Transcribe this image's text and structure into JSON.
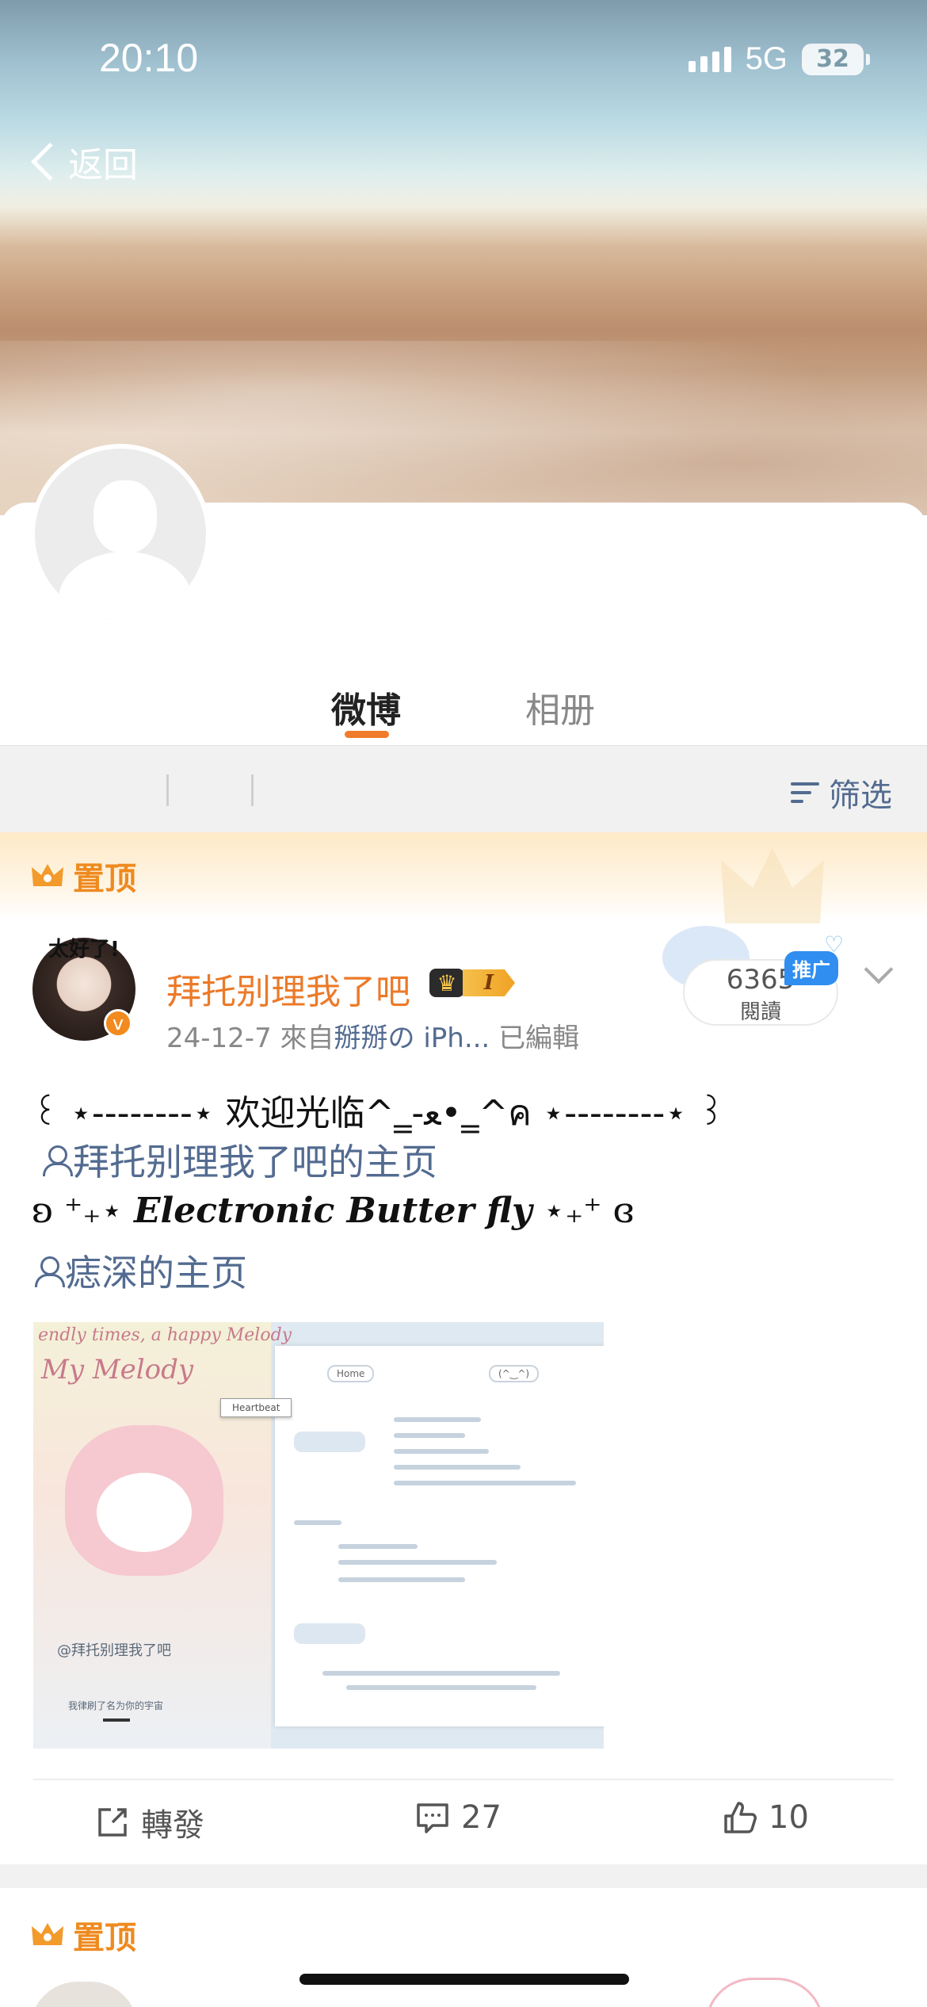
{
  "status_bar": {
    "time": "20:10",
    "network": "5G",
    "battery": "32"
  },
  "nav": {
    "back_label": "返回"
  },
  "tabs": [
    {
      "label": "微博",
      "active": true
    },
    {
      "label": "相册",
      "active": false
    }
  ],
  "filter": {
    "label": "筛选"
  },
  "pinned_label": "置顶",
  "post": {
    "username": "拜托别理我了吧",
    "avatar_caption": "太好了!",
    "vip_level": "I",
    "date": "24-12-7",
    "source_prefix": "來自",
    "source": "掰掰の iPh...",
    "edited": "已編輯",
    "reads": {
      "count": "6365",
      "label": "閱讀"
    },
    "promo_badge": "推广",
    "line1": "꒰ ⋆‐‐‐‐‐‐‐‐⋆  欢迎光临^‗-ﻌ•‗^ค  ⋆‐‐‐‐‐‐‐‐⋆ ꒱",
    "link1": "拜托别理我了吧的主页",
    "line2_prefix": "ʚ ⁺₊⋆ ",
    "line2_main": "Electronic Butter fly",
    "line2_suffix": " ⋆₊⁺ ɞ",
    "link2": "痣深的主页",
    "image": {
      "top_text": "endly times, a happy Melody",
      "title": "My Melody",
      "handle": "@拜托别理我了吧",
      "caption": "我律刷了名为你的宇宙",
      "tag": "Heartbeat",
      "nav_pill_1": "Home",
      "nav_pill_2": "(^‿^)"
    },
    "actions": {
      "repost_label": "轉發",
      "comments": "27",
      "likes": "10"
    }
  },
  "next_pinned_label": "置顶",
  "colors": {
    "accent": "#eb7a29",
    "link": "#536b90",
    "tab_underline": "#f07b2c"
  },
  "icons": [
    "back-chevron-icon",
    "filter-icon",
    "crown-icon",
    "repost-icon",
    "comment-icon",
    "like-icon",
    "person-icon",
    "chevron-down-icon"
  ]
}
